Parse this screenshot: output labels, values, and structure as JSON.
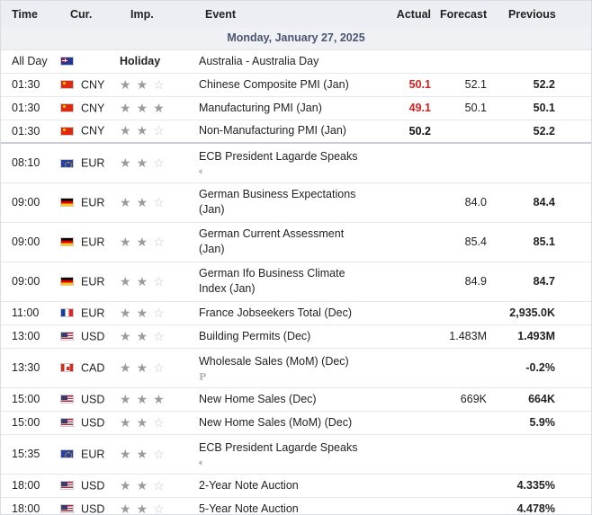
{
  "columns": {
    "time": "Time",
    "cur": "Cur.",
    "imp": "Imp.",
    "event": "Event",
    "actual": "Actual",
    "forecast": "Forecast",
    "previous": "Previous"
  },
  "date_label": "Monday, January 27, 2025",
  "holiday_label": "Holiday",
  "colors": {
    "accent_red": "#d81e1e",
    "header_bg": "#eceef3",
    "star_on": "#9b9b9b",
    "star_off": "#c8c8c8"
  },
  "rows": [
    {
      "time": "All Day",
      "flag": "australia-flag-icon",
      "cur": "",
      "stars": null,
      "holiday": true,
      "event": "Australia - Australia Day",
      "actual": "",
      "actual_color": "",
      "forecast": "",
      "previous": "",
      "sub_icon": ""
    },
    {
      "time": "01:30",
      "flag": "china-flag-icon",
      "cur": "CNY",
      "stars": 2,
      "event": "Chinese Composite PMI (Jan)",
      "actual": "50.1",
      "actual_color": "red",
      "forecast": "52.1",
      "previous": "52.2",
      "sub_icon": ""
    },
    {
      "time": "01:30",
      "flag": "china-flag-icon",
      "cur": "CNY",
      "stars": 3,
      "event": "Manufacturing PMI (Jan)",
      "actual": "49.1",
      "actual_color": "red",
      "forecast": "50.1",
      "previous": "50.1",
      "sub_icon": ""
    },
    {
      "time": "01:30",
      "flag": "china-flag-icon",
      "cur": "CNY",
      "stars": 2,
      "event": "Non-Manufacturing PMI (Jan)",
      "actual": "50.2",
      "actual_color": "black",
      "forecast": "",
      "previous": "52.2",
      "sub_icon": ""
    },
    {
      "time": "08:10",
      "flag": "eu-flag-icon",
      "cur": "EUR",
      "stars": 2,
      "event": "ECB President Lagarde Speaks",
      "actual": "",
      "actual_color": "",
      "forecast": "",
      "previous": "",
      "sub_icon": "speaker-icon"
    },
    {
      "time": "09:00",
      "flag": "germany-flag-icon",
      "cur": "EUR",
      "stars": 2,
      "event": "German Business Expectations (Jan)",
      "actual": "",
      "actual_color": "",
      "forecast": "84.0",
      "previous": "84.4",
      "sub_icon": ""
    },
    {
      "time": "09:00",
      "flag": "germany-flag-icon",
      "cur": "EUR",
      "stars": 2,
      "event": "German Current Assessment (Jan)",
      "actual": "",
      "actual_color": "",
      "forecast": "85.4",
      "previous": "85.1",
      "sub_icon": ""
    },
    {
      "time": "09:00",
      "flag": "germany-flag-icon",
      "cur": "EUR",
      "stars": 2,
      "event": "German Ifo Business Climate Index (Jan)",
      "actual": "",
      "actual_color": "",
      "forecast": "84.9",
      "previous": "84.7",
      "sub_icon": ""
    },
    {
      "time": "11:00",
      "flag": "france-flag-icon",
      "cur": "EUR",
      "stars": 2,
      "event": "France Jobseekers Total (Dec)",
      "actual": "",
      "actual_color": "",
      "forecast": "",
      "previous": "2,935.0K",
      "sub_icon": ""
    },
    {
      "time": "13:00",
      "flag": "usa-flag-icon",
      "cur": "USD",
      "stars": 2,
      "event": "Building Permits (Dec)",
      "actual": "",
      "actual_color": "",
      "forecast": "1.483M",
      "previous": "1.493M",
      "sub_icon": ""
    },
    {
      "time": "13:30",
      "flag": "canada-flag-icon",
      "cur": "CAD",
      "stars": 2,
      "event": "Wholesale Sales (MoM) (Dec)",
      "actual": "",
      "actual_color": "",
      "forecast": "",
      "previous": "-0.2%",
      "sub_icon": "preliminary-icon"
    },
    {
      "time": "15:00",
      "flag": "usa-flag-icon",
      "cur": "USD",
      "stars": 3,
      "event": "New Home Sales (Dec)",
      "actual": "",
      "actual_color": "",
      "forecast": "669K",
      "previous": "664K",
      "sub_icon": ""
    },
    {
      "time": "15:00",
      "flag": "usa-flag-icon",
      "cur": "USD",
      "stars": 2,
      "event": "New Home Sales (MoM) (Dec)",
      "actual": "",
      "actual_color": "",
      "forecast": "",
      "previous": "5.9%",
      "sub_icon": ""
    },
    {
      "time": "15:35",
      "flag": "eu-flag-icon",
      "cur": "EUR",
      "stars": 2,
      "event": "ECB President Lagarde Speaks",
      "actual": "",
      "actual_color": "",
      "forecast": "",
      "previous": "",
      "sub_icon": "speaker-icon"
    },
    {
      "time": "18:00",
      "flag": "usa-flag-icon",
      "cur": "USD",
      "stars": 2,
      "event": "2-Year Note Auction",
      "actual": "",
      "actual_color": "",
      "forecast": "",
      "previous": "4.335%",
      "sub_icon": ""
    },
    {
      "time": "18:00",
      "flag": "usa-flag-icon",
      "cur": "USD",
      "stars": 2,
      "event": "5-Year Note Auction",
      "actual": "",
      "actual_color": "",
      "forecast": "",
      "previous": "4.478%",
      "sub_icon": ""
    }
  ]
}
